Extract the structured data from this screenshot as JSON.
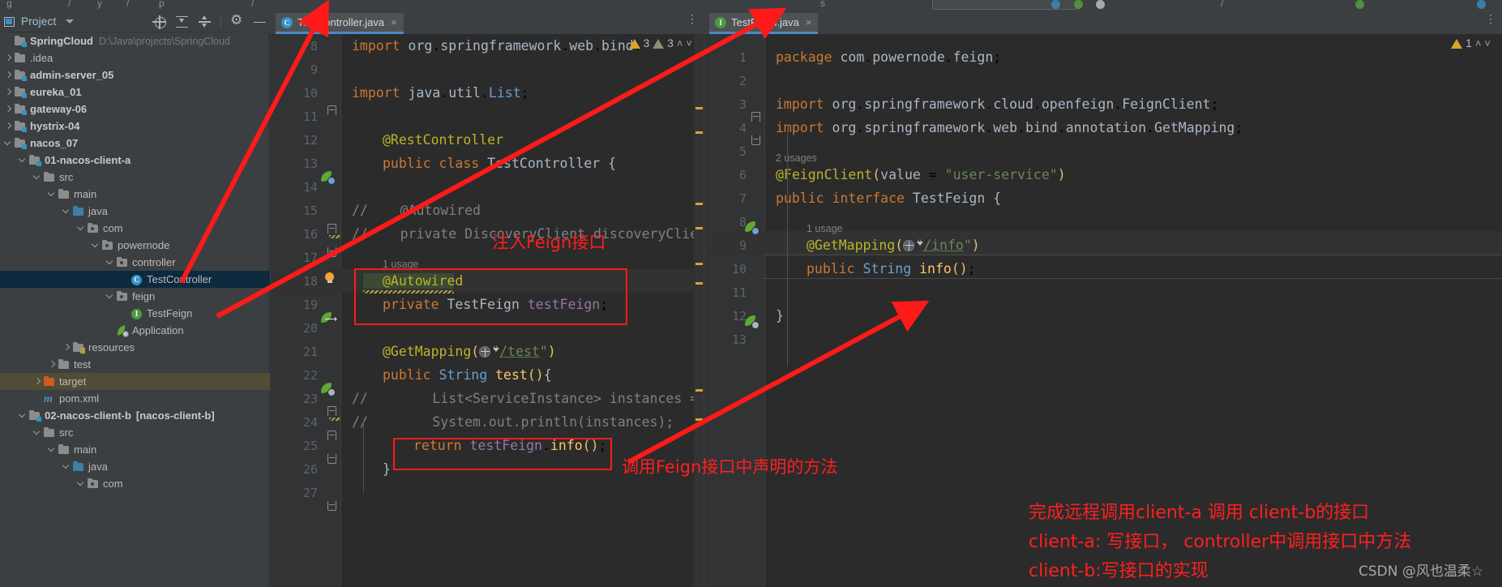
{
  "window": {
    "breadcrumb_fragments": [
      "g",
      "/",
      "y",
      "/",
      "p",
      "/",
      "s",
      "/"
    ]
  },
  "project_panel": {
    "title": "Project",
    "toolbar": {
      "locate_icon": "locate-icon",
      "expand_icon": "expand-all-icon",
      "collapse_icon": "collapse-all-icon",
      "settings_icon": "gear-icon",
      "hide_icon": "minimize-icon"
    },
    "tree": [
      {
        "label": "SpringCloud",
        "path": "D:\\Java\\projects\\SpringCloud",
        "indent": 0,
        "arrow": "none",
        "icon": "module-folder",
        "bold": true
      },
      {
        "label": ".idea",
        "indent": 0,
        "arrow": "right",
        "icon": "folder"
      },
      {
        "label": "admin-server_05",
        "indent": 0,
        "arrow": "right",
        "icon": "module-folder",
        "bold": true
      },
      {
        "label": "eureka_01",
        "indent": 0,
        "arrow": "right",
        "icon": "module-folder",
        "bold": true
      },
      {
        "label": "gateway-06",
        "indent": 0,
        "arrow": "right",
        "icon": "module-folder",
        "bold": true
      },
      {
        "label": "hystrix-04",
        "indent": 0,
        "arrow": "right",
        "icon": "module-folder",
        "bold": true
      },
      {
        "label": "nacos_07",
        "indent": 0,
        "arrow": "down",
        "icon": "module-folder",
        "bold": true
      },
      {
        "label": "01-nacos-client-a",
        "indent": 1,
        "arrow": "down",
        "icon": "module-folder",
        "bold": true
      },
      {
        "label": "src",
        "indent": 2,
        "arrow": "down",
        "icon": "folder"
      },
      {
        "label": "main",
        "indent": 3,
        "arrow": "down",
        "icon": "folder"
      },
      {
        "label": "java",
        "indent": 4,
        "arrow": "down",
        "icon": "folder-blue"
      },
      {
        "label": "com",
        "indent": 5,
        "arrow": "down",
        "icon": "package"
      },
      {
        "label": "powernode",
        "indent": 6,
        "arrow": "down",
        "icon": "package"
      },
      {
        "label": "controller",
        "indent": 7,
        "arrow": "down",
        "icon": "package"
      },
      {
        "label": "TestController",
        "indent": 8,
        "arrow": "none",
        "icon": "class",
        "selected": true
      },
      {
        "label": "feign",
        "indent": 7,
        "arrow": "down",
        "icon": "package"
      },
      {
        "label": "TestFeign",
        "indent": 8,
        "arrow": "none",
        "icon": "interface"
      },
      {
        "label": "Application",
        "indent": 7,
        "arrow": "none",
        "icon": "spring-app"
      },
      {
        "label": "resources",
        "indent": 4,
        "arrow": "right",
        "icon": "resources-folder"
      },
      {
        "label": "test",
        "indent": 3,
        "arrow": "right",
        "icon": "folder"
      },
      {
        "label": "target",
        "indent": 2,
        "arrow": "right",
        "icon": "folder-orange",
        "excluded": true
      },
      {
        "label": "pom.xml",
        "indent": 2,
        "arrow": "none",
        "icon": "maven"
      },
      {
        "label": "02-nacos-client-b",
        "suffix": "[nacos-client-b]",
        "indent": 1,
        "arrow": "down",
        "icon": "module-folder",
        "bold": true
      },
      {
        "label": "src",
        "indent": 2,
        "arrow": "down",
        "icon": "folder"
      },
      {
        "label": "main",
        "indent": 3,
        "arrow": "down",
        "icon": "folder"
      },
      {
        "label": "java",
        "indent": 4,
        "arrow": "down",
        "icon": "folder-blue"
      },
      {
        "label": "com",
        "indent": 5,
        "arrow": "down",
        "icon": "package"
      }
    ]
  },
  "editor_left": {
    "tab": {
      "label": "TestController.java",
      "icon": "class-icon",
      "close": "×"
    },
    "overflow_icon": "more-vertical-icon",
    "inspection": {
      "warn_count": "3",
      "weak_count": "3",
      "warn_icon": "warning-triangle-icon",
      "weak_icon": "weak-warning-triangle-icon",
      "prev": "˄",
      "next": "˅"
    },
    "lines": [
      {
        "num": "8",
        "text": "import org.springframework.web.bind."
      },
      {
        "num": "9",
        "text": ""
      },
      {
        "num": "10",
        "text": "import java.util.List;"
      },
      {
        "num": "11",
        "text": ""
      },
      {
        "num": "12",
        "text": "@RestController"
      },
      {
        "num": "13",
        "text": "public class TestController {"
      },
      {
        "num": "14",
        "text": ""
      },
      {
        "num": "15",
        "text": "//    @Autowired"
      },
      {
        "num": "16",
        "text": "//    private DiscoveryClient discoveryClient"
      },
      {
        "num": "17",
        "text": ""
      },
      {
        "num": "18",
        "text": "@Autowired",
        "hint": "1 usage"
      },
      {
        "num": "19",
        "text": "private TestFeign testFeign;"
      },
      {
        "num": "20",
        "text": ""
      },
      {
        "num": "21",
        "text": "@GetMapping(\"/test\")"
      },
      {
        "num": "22",
        "text": "public String test(){"
      },
      {
        "num": "23",
        "text": "//        List<ServiceInstance> instances = d"
      },
      {
        "num": "24",
        "text": "//        System.out.println(instances);"
      },
      {
        "num": "25",
        "text": "return testFeign.info();"
      },
      {
        "num": "26",
        "text": "}"
      },
      {
        "num": "27",
        "text": ""
      }
    ]
  },
  "editor_right": {
    "tab": {
      "label": "TestFeign.java",
      "icon": "interface-icon",
      "close": "×"
    },
    "overflow_icon": "more-vertical-icon",
    "inspection": {
      "warn_count": "1",
      "warn_icon": "warning-triangle-icon",
      "prev": "˄",
      "next": "˅"
    },
    "lines": [
      {
        "num": "1",
        "text": "package com.powernode.feign;"
      },
      {
        "num": "2",
        "text": ""
      },
      {
        "num": "3",
        "text": "import org.springframework.cloud.openfeign.FeignClient;"
      },
      {
        "num": "4",
        "text": "import org.springframework.web.bind.annotation.GetMapping;"
      },
      {
        "num": "5",
        "text": ""
      },
      {
        "num": "6",
        "text": "@FeignClient(value = \"user-service\")",
        "hint": "2 usages"
      },
      {
        "num": "7",
        "text": "public interface TestFeign {"
      },
      {
        "num": "8",
        "text": ""
      },
      {
        "num": "9",
        "text": "@GetMapping(\"/info\")",
        "hint": "1 usage"
      },
      {
        "num": "10",
        "text": "public String info();"
      },
      {
        "num": "11",
        "text": ""
      },
      {
        "num": "12",
        "text": "}"
      },
      {
        "num": "13",
        "text": ""
      }
    ]
  },
  "annotations": {
    "inject_feign": "注入Feign接口",
    "call_method": "调用Feign接口中声明的方法",
    "summary_line1": "完成远程调用client-a 调用 client-b的接口",
    "summary_line2": "client-a: 写接口， controller中调用接口中方法",
    "summary_line3": "client-b:写接口的实现",
    "watermark": "CSDN @风也温柔☆",
    "arrow_color": "#ff1a1a"
  }
}
